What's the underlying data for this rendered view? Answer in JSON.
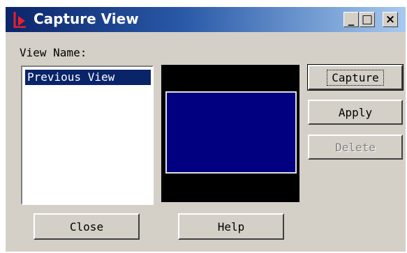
{
  "window": {
    "title": "Capture View"
  },
  "titlebar_buttons": {
    "minimize": "_",
    "maximize": "□",
    "close": "×"
  },
  "labels": {
    "view_name": "View Name:"
  },
  "views_list": {
    "items": [
      "Previous View"
    ],
    "selected": "Previous View"
  },
  "buttons": {
    "capture": "Capture",
    "apply": "Apply",
    "delete": "Delete",
    "close": "Close",
    "help": "Help"
  },
  "button_states": {
    "delete": "disabled",
    "capture": "focused"
  },
  "colors": {
    "title_gradient_start": "#0b246a",
    "title_gradient_end": "#a6caf0",
    "dialog_bg": "#d4d0c8",
    "selection": "#0a246a",
    "preview_fill": "#000080",
    "preview_border": "#000000"
  },
  "icons": {
    "app": "capture-view-app-icon"
  }
}
